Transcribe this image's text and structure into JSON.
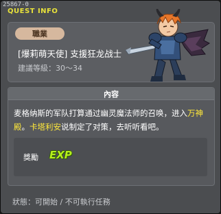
{
  "window": {
    "quest_id": "25867-0",
    "title": "QUEST INFO"
  },
  "header": {
    "job_badge": "職業",
    "job_name": "[爆莉萌天使] 支援狂龙战士",
    "level_range": "建議等級：30～34"
  },
  "content": {
    "header": "內容",
    "description_part1": "麦格纳斯的军队打算通过幽灵魔法师的召唤，进入",
    "highlight1": "万神殿",
    "description_part2": "。",
    "highlight2": "卡塔利安",
    "description_part3": "说制定了对策，去听听看吧。",
    "reward_label": "獎勵",
    "reward_icon": "exp-icon",
    "reward_text": "EXP"
  },
  "status": {
    "text": "狀態：可開始 / 不可執行任務"
  },
  "colors": {
    "title": "#e8e23a",
    "highlight": "#ffe83a",
    "exp": "#b6f01c",
    "badge": "#d6b89e"
  }
}
